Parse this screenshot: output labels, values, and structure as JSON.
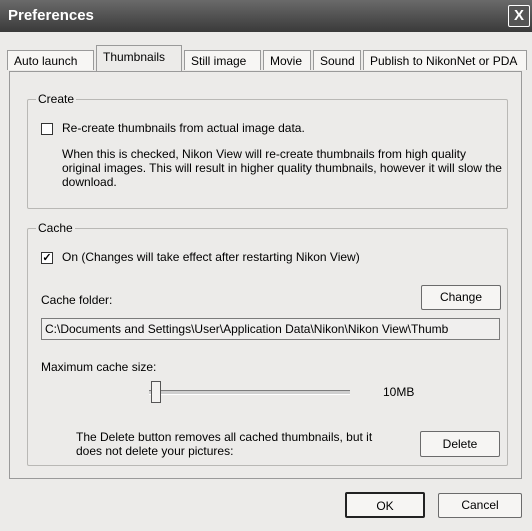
{
  "window": {
    "title": "Preferences",
    "close_label": "X"
  },
  "tabs": [
    {
      "label": "Auto launch"
    },
    {
      "label": "Thumbnails"
    },
    {
      "label": "Still image"
    },
    {
      "label": "Movie"
    },
    {
      "label": "Sound"
    },
    {
      "label": "Publish to NikonNet or PDA"
    }
  ],
  "create": {
    "legend": "Create",
    "checkbox_label": "Re-create thumbnails from actual image data.",
    "checked": false,
    "description": "When this is checked, Nikon View will re-create thumbnails from high quality original images. This will result in higher quality thumbnails, however it will slow the download."
  },
  "cache": {
    "legend": "Cache",
    "on_label": "On (Changes will take effect after restarting Nikon View)",
    "on_checked": true,
    "folder_label": "Cache folder:",
    "change_button": "Change",
    "folder_path": "C:\\Documents and Settings\\User\\Application Data\\Nikon\\Nikon View\\Thumb",
    "max_size_label": "Maximum cache size:",
    "max_size_value": "10MB",
    "delete_note": "The Delete button removes all cached thumbnails, but it does not delete your pictures:",
    "delete_button": "Delete"
  },
  "footer": {
    "ok_button": "OK",
    "cancel_button": "Cancel"
  }
}
